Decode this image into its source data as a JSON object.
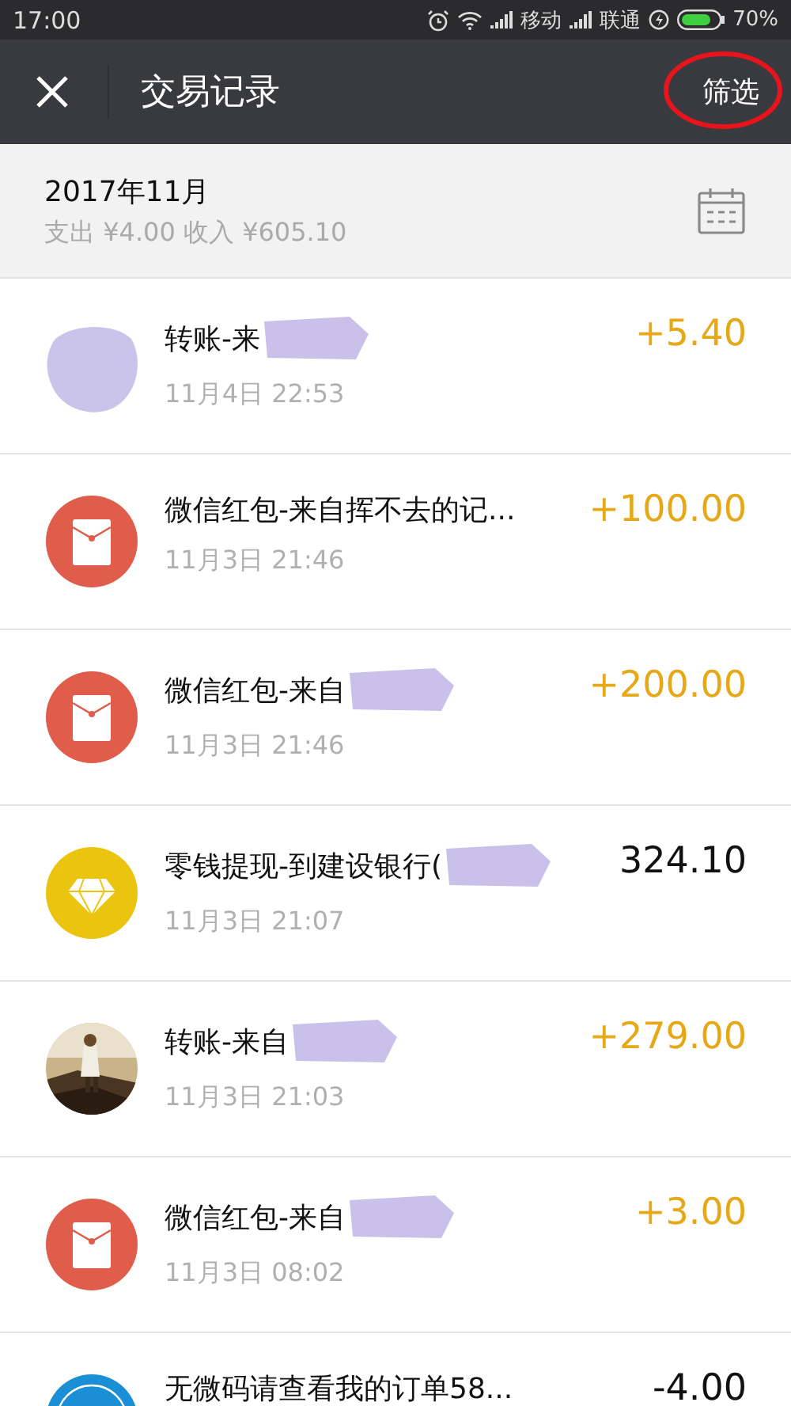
{
  "status_bar": {
    "time": "17:00",
    "carriers": [
      "移动",
      "联通"
    ],
    "battery": "70%"
  },
  "nav": {
    "title": "交易记录",
    "filter_button": {
      "label": "筛选",
      "circled": true
    }
  },
  "summary": {
    "month": "2017年11月",
    "totals": "支出 ¥4.00 收入 ¥605.10"
  },
  "rows": [
    {
      "kind": "redacted",
      "title": "转账-来",
      "redacted": true,
      "time": "11月4日 22:53",
      "amount": "+5.40",
      "income": true
    },
    {
      "kind": "red-packet",
      "title": "微信红包-来自挥不去的记...",
      "redacted": false,
      "time": "11月3日 21:46",
      "amount": "+100.00",
      "income": true
    },
    {
      "kind": "red-packet",
      "title": "微信红包-来自",
      "redacted": true,
      "time": "11月3日 21:46",
      "amount": "+200.00",
      "income": true
    },
    {
      "kind": "diamond",
      "title": "零钱提现-到建设银行(",
      "redacted": true,
      "time": "11月3日 21:07",
      "amount": "324.10",
      "income": false
    },
    {
      "title": "转账-来自",
      "redacted": true,
      "time": "11月3日 21:03",
      "amount": "+279.00",
      "income": true
    },
    {
      "kind": "red-packet",
      "title": "微信红包-来自",
      "redacted": true,
      "time": "11月3日 08:02",
      "amount": "+3.00",
      "income": true
    },
    {
      "kind": "logo",
      "title": "无微码请查看我的订单58...",
      "redacted": false,
      "amount": "-4.00",
      "income": false
    }
  ]
}
